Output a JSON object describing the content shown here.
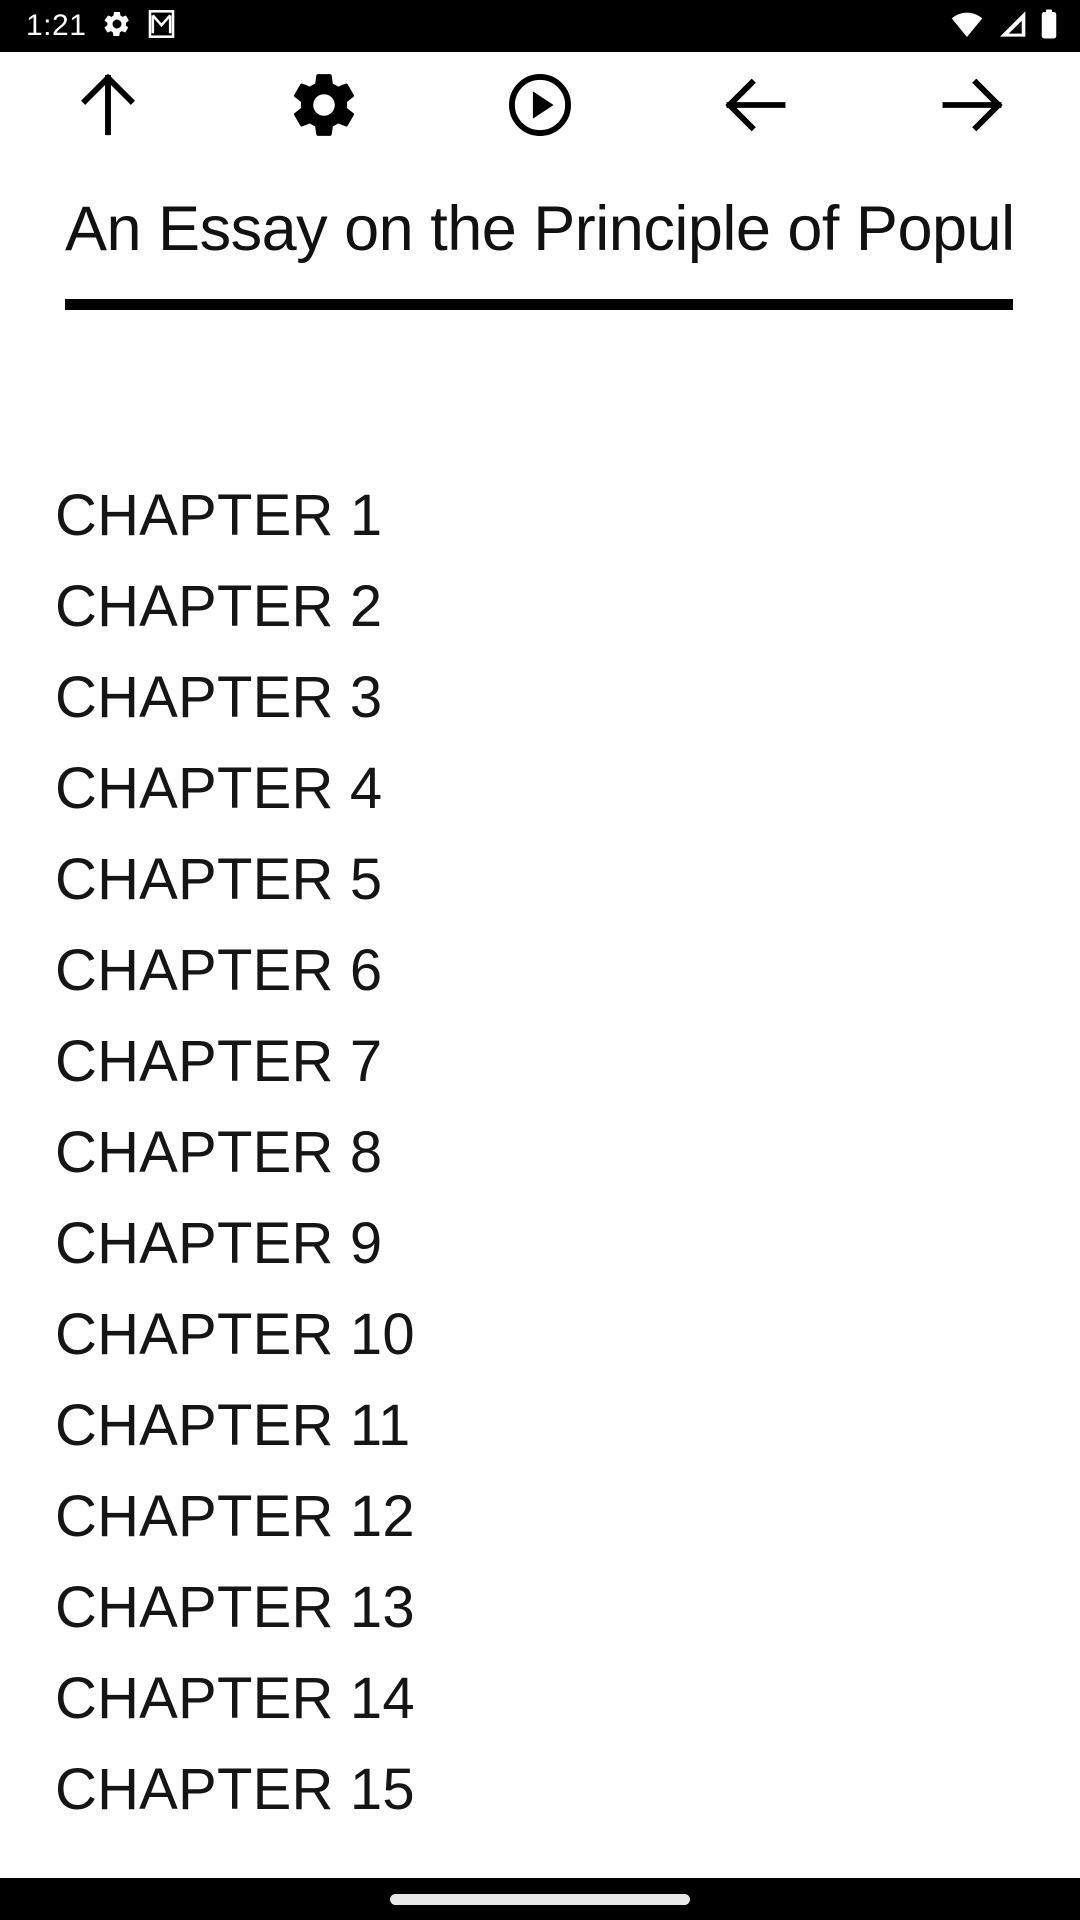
{
  "status_bar": {
    "time": "1:21",
    "left_icons": [
      "gear-icon",
      "gmail-icon"
    ],
    "right_icons": [
      "wifi-icon",
      "cell-signal-icon",
      "battery-icon"
    ],
    "background_color": "#000000",
    "foreground_color": "#ffffff"
  },
  "toolbar": {
    "buttons": [
      {
        "name": "scroll-to-top",
        "icon": "arrow-up-icon",
        "label": "Top"
      },
      {
        "name": "settings",
        "icon": "gear-icon",
        "label": "Settings"
      },
      {
        "name": "play",
        "icon": "play-circle-icon",
        "label": "Play"
      },
      {
        "name": "previous",
        "icon": "arrow-left-icon",
        "label": "Previous"
      },
      {
        "name": "next",
        "icon": "arrow-right-icon",
        "label": "Next"
      }
    ],
    "icon_color": "#000000",
    "background_color": "#ffffff"
  },
  "book": {
    "title": "An Essay on the Principle of Popul",
    "title_underline_color": "#000000"
  },
  "chapters": [
    {
      "label": "CHAPTER 1"
    },
    {
      "label": "CHAPTER 2"
    },
    {
      "label": "CHAPTER 3"
    },
    {
      "label": "CHAPTER 4"
    },
    {
      "label": "CHAPTER 5"
    },
    {
      "label": "CHAPTER 6"
    },
    {
      "label": "CHAPTER 7"
    },
    {
      "label": "CHAPTER 8"
    },
    {
      "label": "CHAPTER 9"
    },
    {
      "label": "CHAPTER 10"
    },
    {
      "label": "CHAPTER 11"
    },
    {
      "label": "CHAPTER 12"
    },
    {
      "label": "CHAPTER 13"
    },
    {
      "label": "CHAPTER 14"
    },
    {
      "label": "CHAPTER 15"
    }
  ],
  "nav_bar": {
    "gesture_pill": "home-gesture-pill",
    "background_color": "#000000",
    "pill_color": "#e8e8e8"
  }
}
